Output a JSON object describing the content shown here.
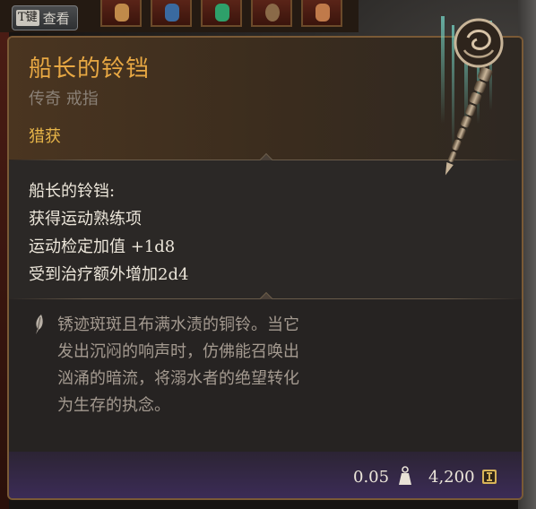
{
  "key_hint": {
    "key": "T键",
    "label": "查看"
  },
  "item": {
    "name": "船长的铃铛",
    "subtitle": "传奇 戒指",
    "source": "猎获",
    "properties": [
      "船长的铃铛:",
      "获得运动熟练项",
      "运动检定加值 +1d8",
      "受到治疗额外增加2d4"
    ],
    "description": [
      "锈迹斑斑且布满水渍的铜铃。当它",
      "发出沉闷的响声时，仿佛能召唤出",
      "汹涌的暗流，将溺水者的绝望转化",
      "为生存的执念。"
    ],
    "weight": "0.05",
    "price": "4,200"
  },
  "colors": {
    "name": "#e8a843",
    "source": "#e6b448",
    "border": "#7a5a36",
    "subtitle": "#8a8076",
    "description": "#a49a90"
  },
  "icons": {
    "weight": "weight-icon",
    "price": "gold-coin-icon",
    "lore": "quill-icon",
    "item": "bell-artwork"
  }
}
